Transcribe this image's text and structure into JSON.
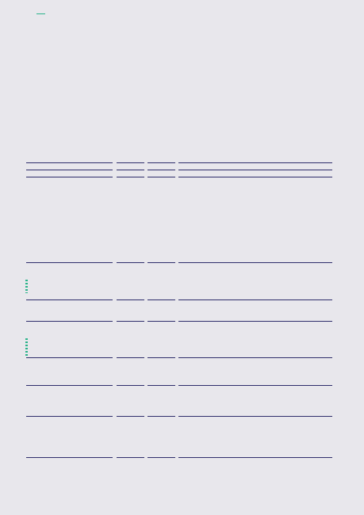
{
  "colors": {
    "background": "#e8e7ec",
    "rule": "#2e2d6b",
    "accent": "#2bb38a"
  }
}
